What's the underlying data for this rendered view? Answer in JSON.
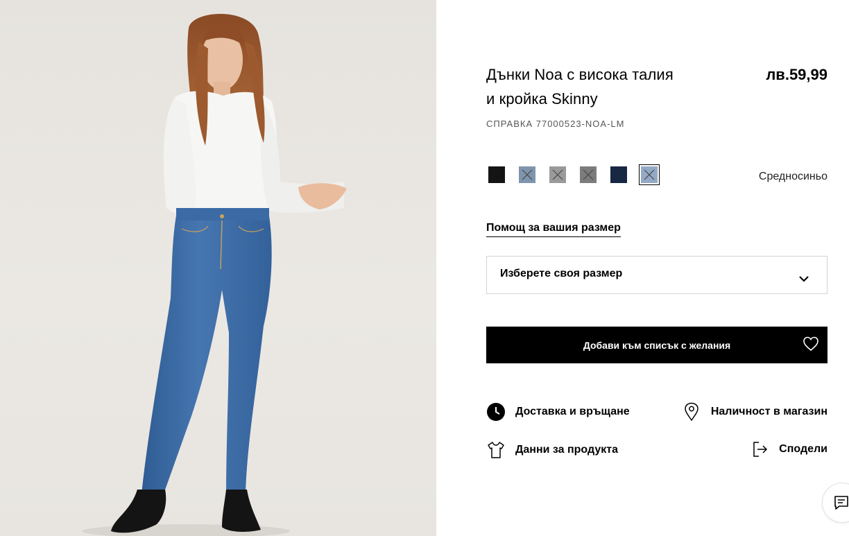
{
  "product": {
    "title_line1": "Дънки Noa с висока талия",
    "title_line2": "и кройка Skinny",
    "price": "лв.59,99",
    "reference": "СПРАВКА 77000523-NOA-LM"
  },
  "colors": {
    "selected_name": "Средносиньо",
    "swatches": [
      {
        "hex": "#141414",
        "available": true
      },
      {
        "hex": "#7f95ad",
        "available": false
      },
      {
        "hex": "#9a9a9a",
        "available": false
      },
      {
        "hex": "#7c7c7c",
        "available": false
      },
      {
        "hex": "#182742",
        "available": true
      },
      {
        "hex": "#93a9c6",
        "available": false,
        "selected": true
      }
    ]
  },
  "size": {
    "help_link": "Помощ за вашия размер",
    "select_placeholder": "Изберете своя размер"
  },
  "actions": {
    "wishlist_label": "Добави към списък с желания"
  },
  "info_links": {
    "delivery": "Доставка и връщане",
    "store_availability": "Наличност в магазин",
    "product_data": "Данни за продукта",
    "share": "Сподели"
  },
  "icons": {
    "delivery": "clock-icon",
    "store_availability": "location-pin-icon",
    "product_data": "tshirt-icon",
    "share": "share-icon",
    "wishlist": "heart-icon",
    "size_select": "chevron-down-icon",
    "chat": "chat-icon"
  }
}
